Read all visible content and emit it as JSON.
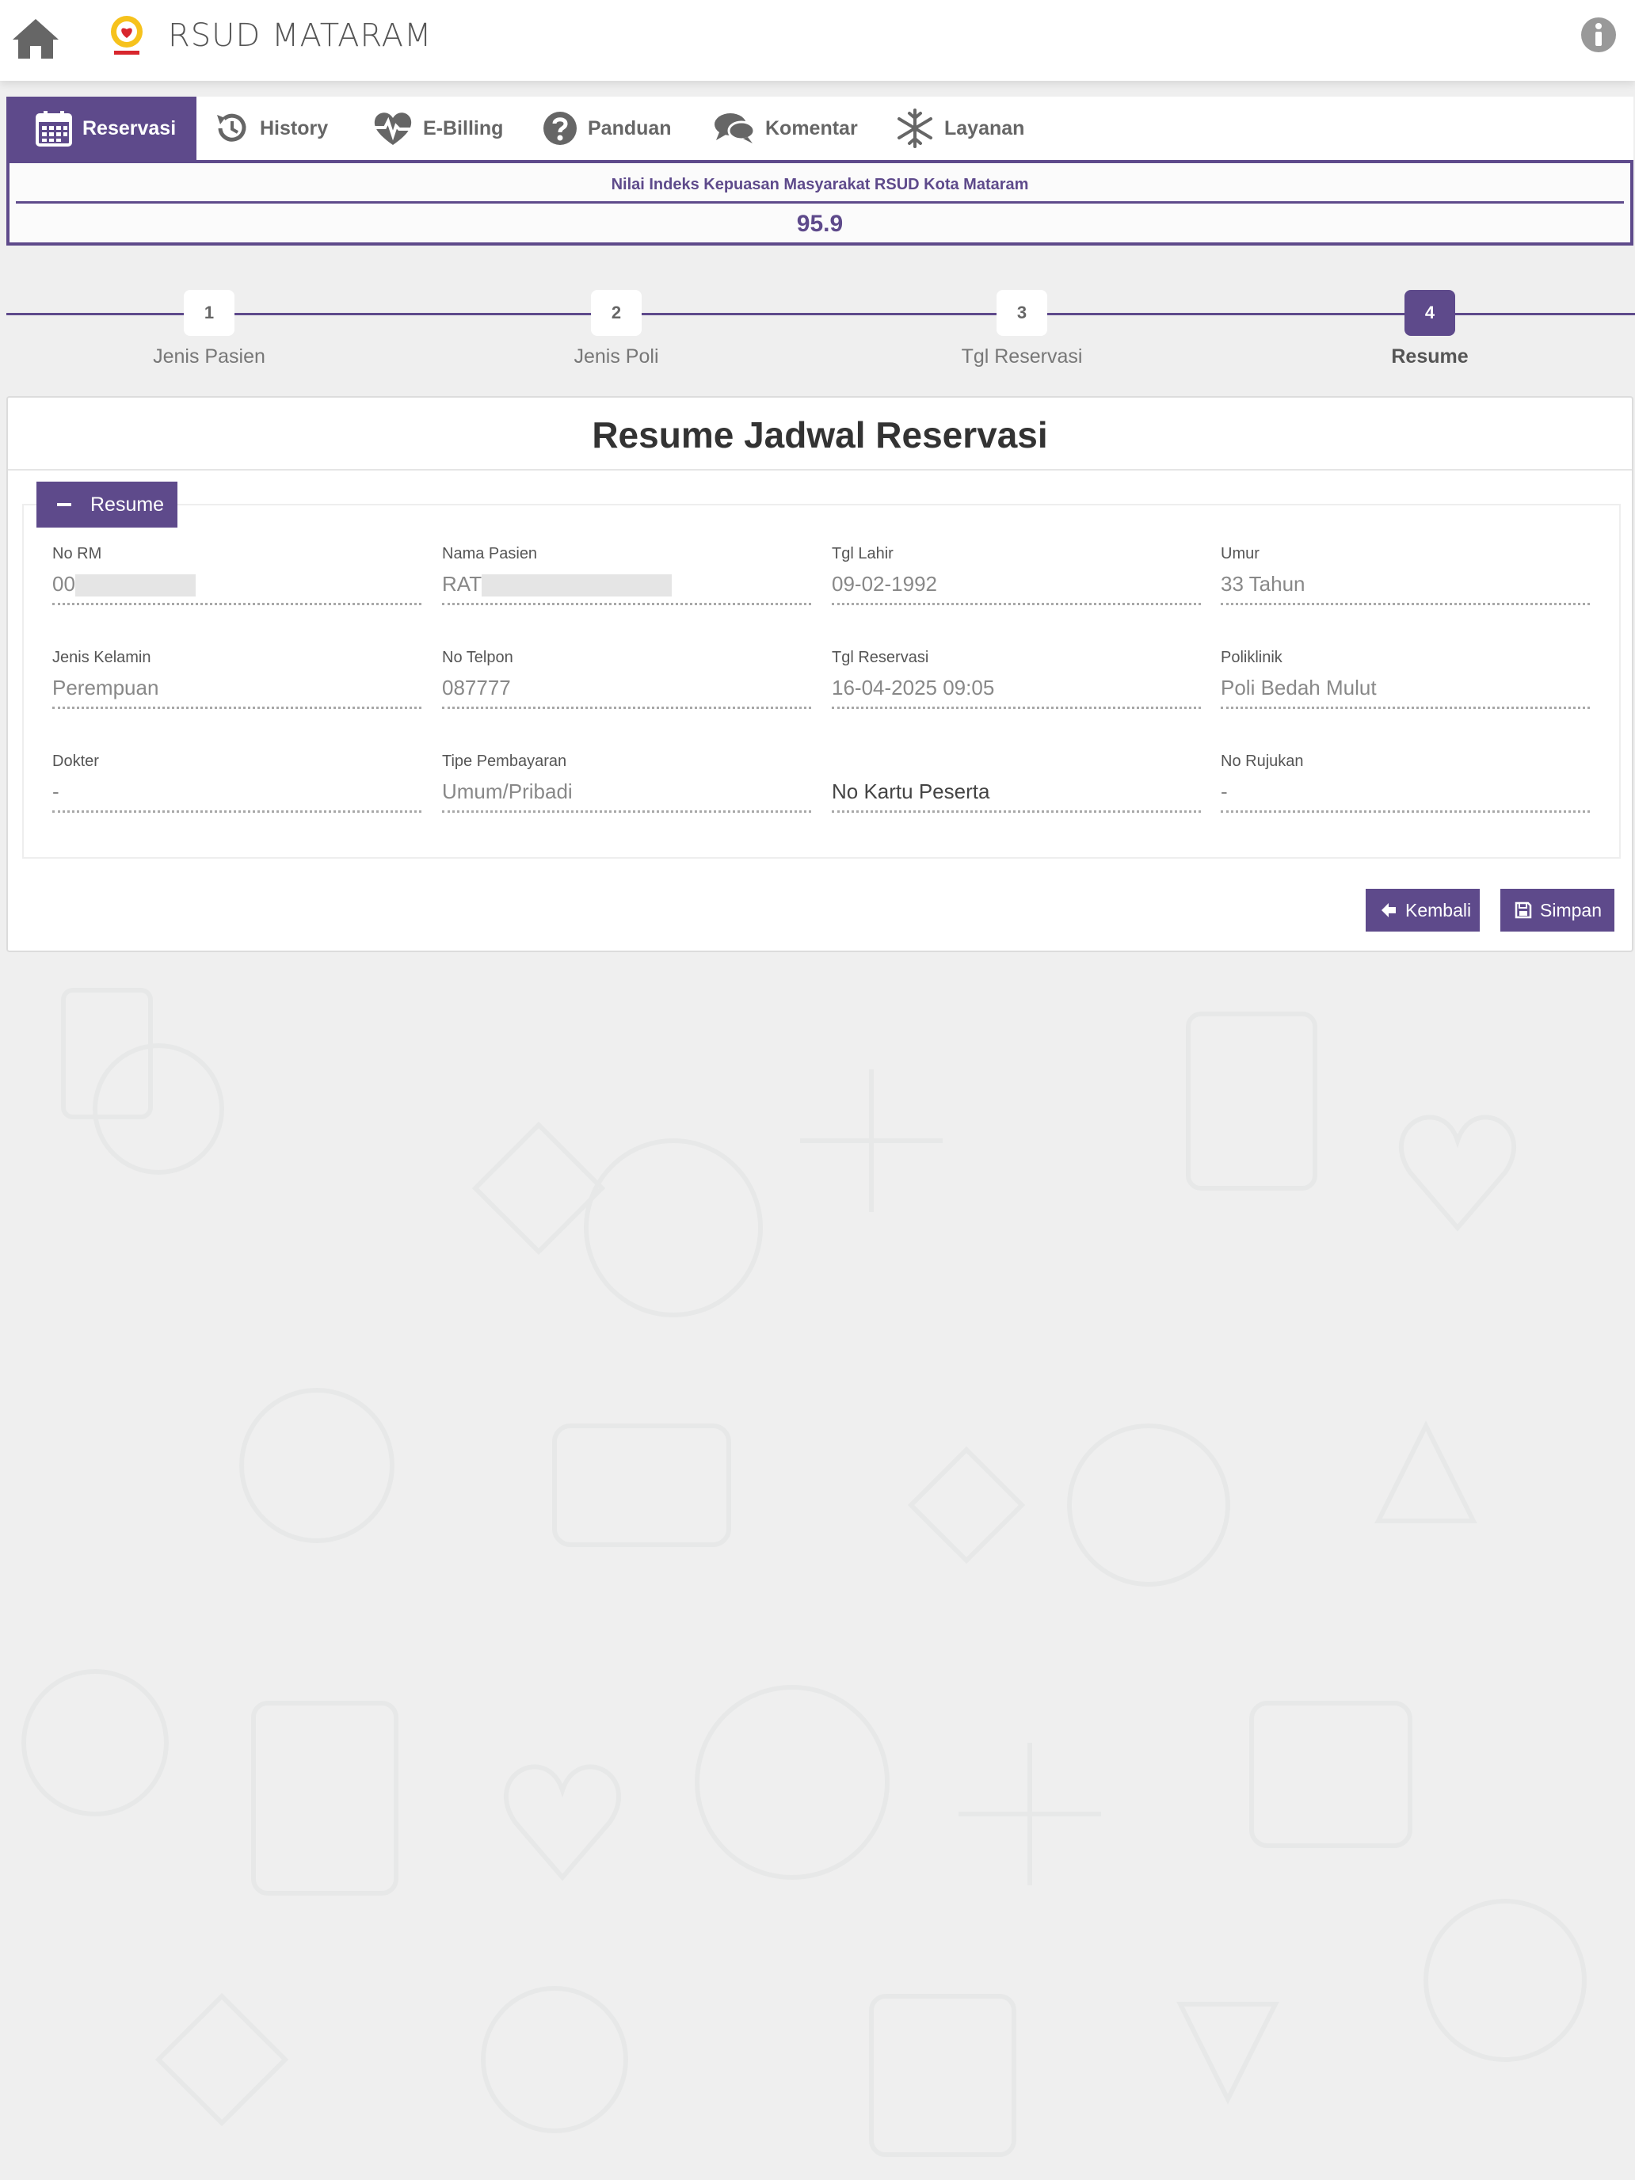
{
  "header": {
    "app_title": "RSUD MATARAM"
  },
  "nav": {
    "tabs": [
      {
        "label": "Reservasi",
        "icon": "calendar-icon",
        "active": true
      },
      {
        "label": "History",
        "icon": "history-icon"
      },
      {
        "label": "E-Billing",
        "icon": "heartbeat-icon"
      },
      {
        "label": "Panduan",
        "icon": "question-icon"
      },
      {
        "label": "Komentar",
        "icon": "comments-icon"
      },
      {
        "label": "Layanan",
        "icon": "snowflake-icon"
      }
    ]
  },
  "index": {
    "label": "Nilai Indeks Kepuasan Masyarakat RSUD Kota Mataram",
    "value": "95.9"
  },
  "stepper": {
    "steps": [
      {
        "number": "1",
        "label": "Jenis Pasien"
      },
      {
        "number": "2",
        "label": "Jenis Poli"
      },
      {
        "number": "3",
        "label": "Tgl Reservasi"
      },
      {
        "number": "4",
        "label": "Resume",
        "active": true
      }
    ]
  },
  "card": {
    "title": "Resume Jadwal Reservasi",
    "panel_tab": "Resume"
  },
  "fields": {
    "no_rm": {
      "label": "No RM",
      "value": "00"
    },
    "nama_pasien": {
      "label": "Nama Pasien",
      "value": "RAT"
    },
    "tgl_lahir": {
      "label": "Tgl Lahir",
      "value": "09-02-1992"
    },
    "umur": {
      "label": "Umur",
      "value": "33 Tahun"
    },
    "jenis_kelamin": {
      "label": "Jenis Kelamin",
      "value": "Perempuan"
    },
    "no_telpon": {
      "label": "No Telpon",
      "value": "087777"
    },
    "tgl_reservasi": {
      "label": "Tgl Reservasi",
      "value": "16-04-2025 09:05"
    },
    "poliklinik": {
      "label": "Poliklinik",
      "value": "Poli Bedah Mulut"
    },
    "dokter": {
      "label": "Dokter",
      "value": "-"
    },
    "tipe_pembayaran": {
      "label": "Tipe Pembayaran",
      "value": "Umum/Pribadi"
    },
    "no_kartu_peserta": {
      "label": "",
      "value": "No Kartu Peserta"
    },
    "no_rujukan": {
      "label": "No Rujukan",
      "value": "-"
    }
  },
  "actions": {
    "back_label": "Kembali",
    "save_label": "Simpan"
  },
  "colors": {
    "accent": "#5e4a8b",
    "background": "#efefef"
  }
}
